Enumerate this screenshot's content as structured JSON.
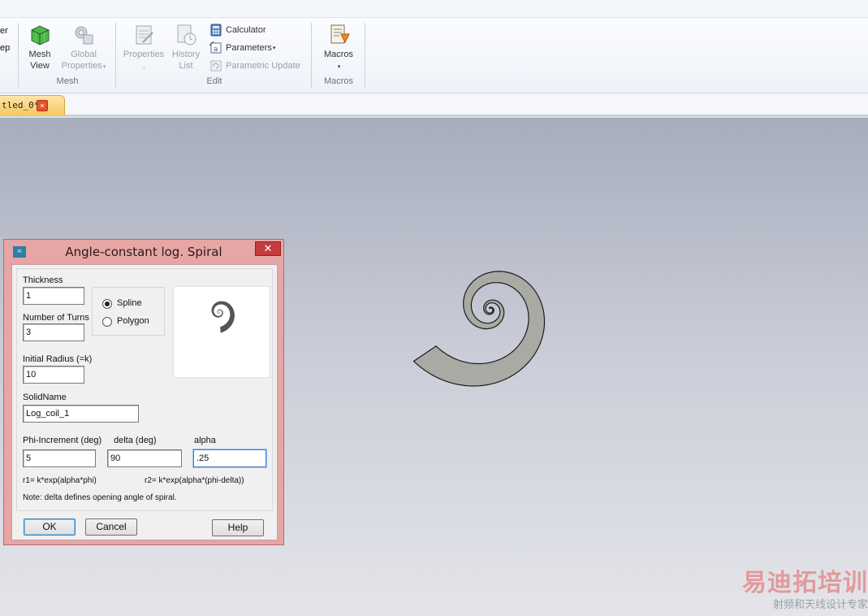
{
  "ribbon": {
    "clipped_left": [
      "er",
      "ep"
    ],
    "mesh_group": {
      "label": "Mesh",
      "mesh_view": [
        "Mesh",
        "View"
      ],
      "global_properties": [
        "Global",
        "Properties"
      ]
    },
    "edit_group": {
      "label": "Edit",
      "properties": "Properties",
      "history": [
        "History",
        "List"
      ],
      "calculator": "Calculator",
      "parameters": "Parameters",
      "parametric_update": "Parametric Update"
    },
    "macros_group": {
      "label": "Macros",
      "macros_button": "Macros"
    }
  },
  "tabs": {
    "doc_tab": "tled_0*",
    "close_glyph": "×"
  },
  "dialog": {
    "title": "Angle-constant log. Spiral",
    "close_glyph": "✕",
    "thickness": {
      "label": "Thickness",
      "value": "1"
    },
    "turns": {
      "label": "Number of Turns",
      "value": "3"
    },
    "radius": {
      "label": "Initial Radius (=k)",
      "value": "10"
    },
    "solidname": {
      "label": "SolidName",
      "value": "Log_coil_1"
    },
    "curve_type": {
      "options": [
        "Spline",
        "Polygon"
      ],
      "selected": "Spline"
    },
    "phi_increment": {
      "label": "Phi-Increment (deg)",
      "value": "5"
    },
    "delta": {
      "label": "delta (deg)",
      "value": "90"
    },
    "alpha": {
      "label": "alpha",
      "value": ".25"
    },
    "formula_r1": "r1= k*exp(alpha*phi)",
    "formula_r2": "r2= k*exp(alpha*(phi-delta))",
    "note": "Note: delta defines opening angle of spiral.",
    "buttons": {
      "ok": "OK",
      "cancel": "Cancel",
      "help": "Help"
    }
  },
  "watermark": {
    "main": "易迪拓培训",
    "sub": "射频和天线设计专家"
  },
  "colors": {
    "spiral_fill": "#a9aaa3",
    "preview_fill": "#545454",
    "accent_dialog": "#e7a5a5",
    "tab_active": "#f6c85e"
  }
}
